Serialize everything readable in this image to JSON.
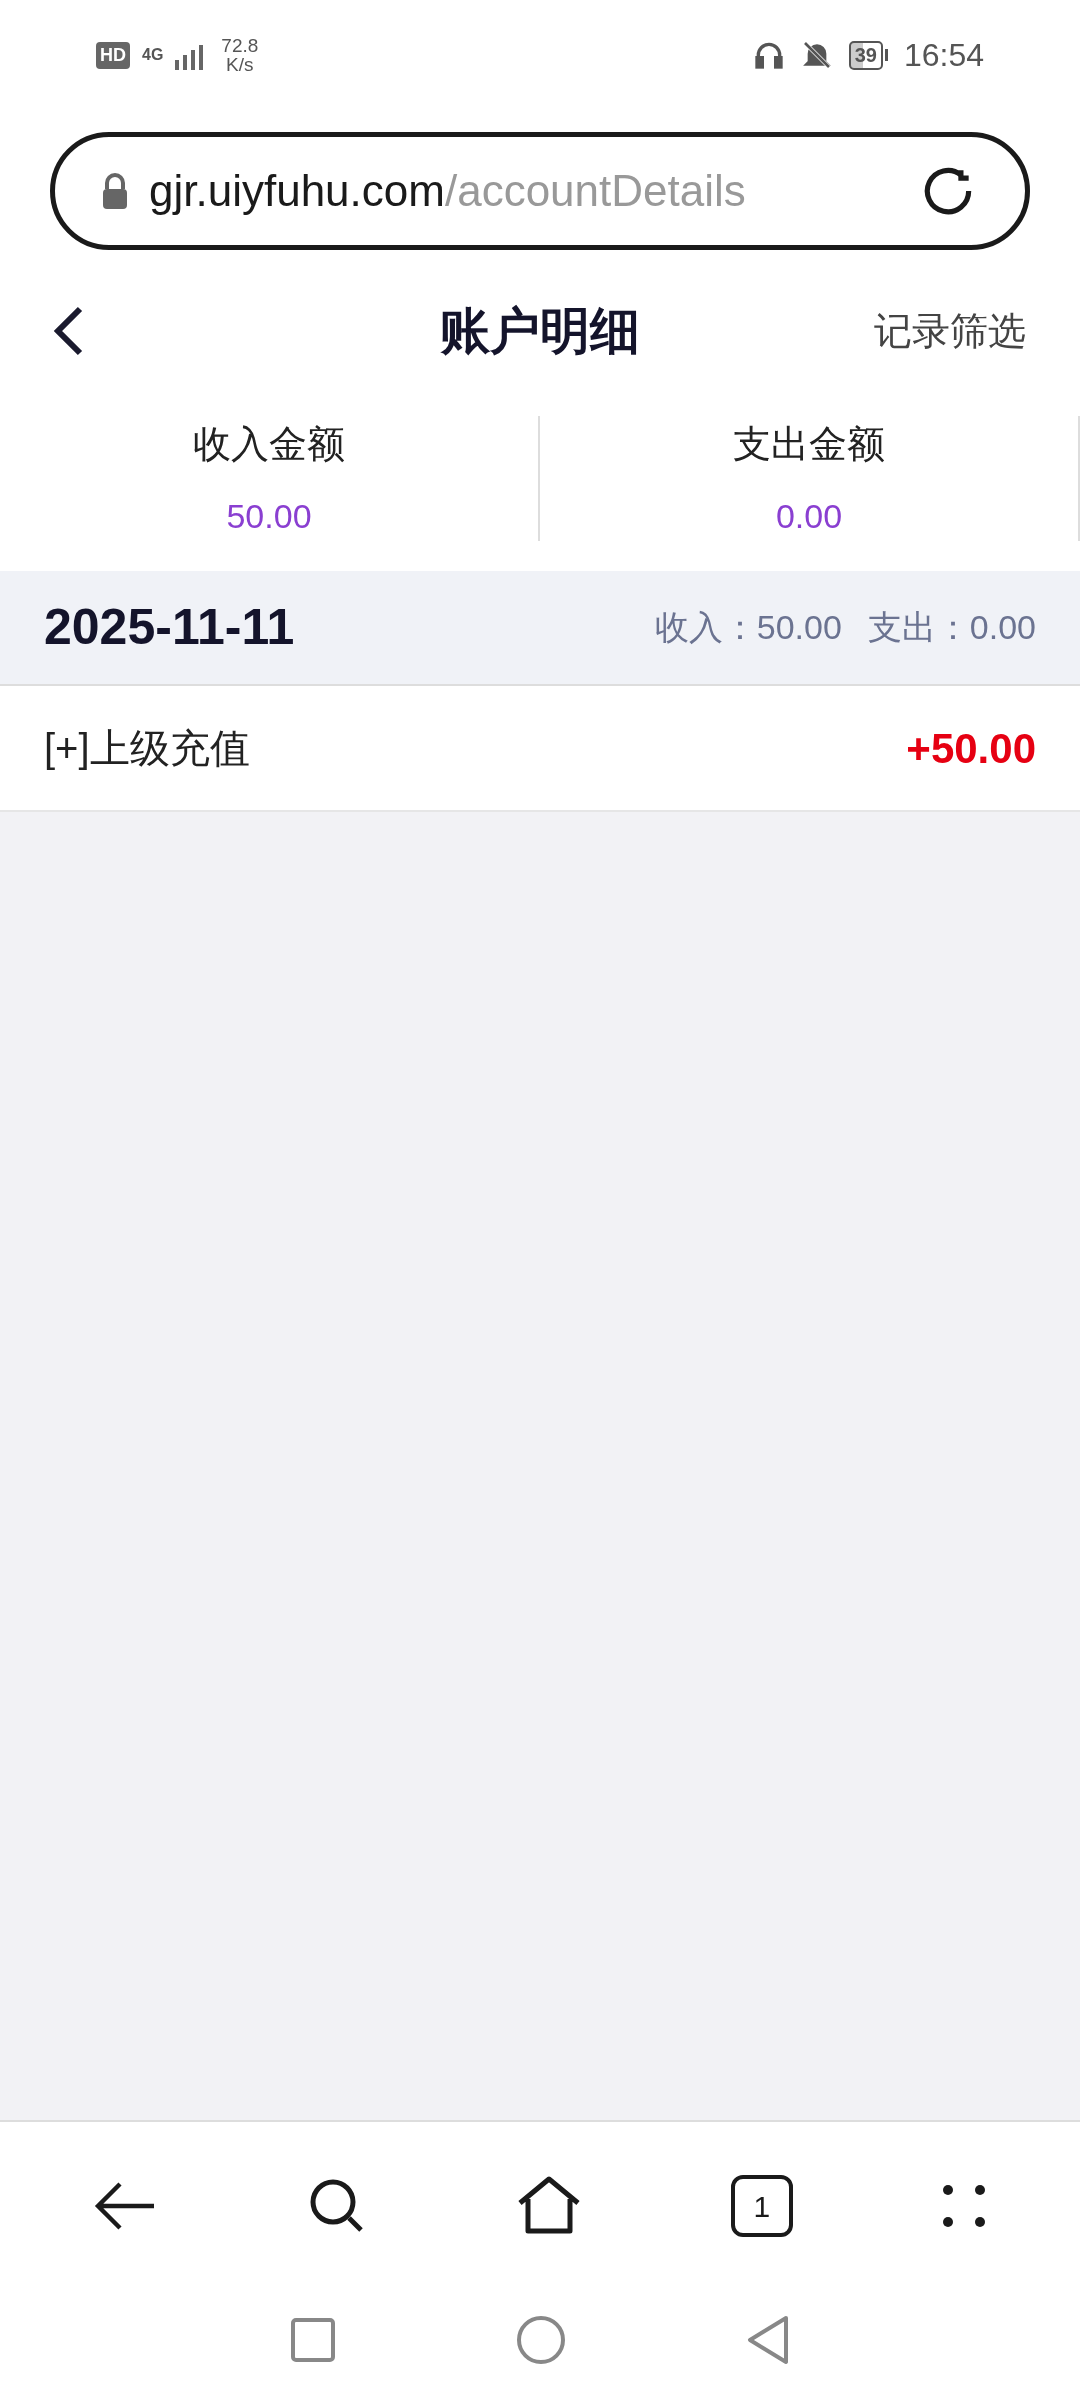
{
  "status_bar": {
    "hd": "HD",
    "network": "4G",
    "speed_value": "72.8",
    "speed_unit": "K/s",
    "battery": "39",
    "time": "16:54"
  },
  "address_bar": {
    "domain": "gjr.uiyfuhu.com",
    "path": "/accountDetails"
  },
  "header": {
    "title": "账户明细",
    "action": "记录筛选"
  },
  "summary": [
    {
      "label": "收入金额",
      "value": "50.00"
    },
    {
      "label": "支出金额",
      "value": "0.00"
    }
  ],
  "groups": [
    {
      "date": "2025-11-11",
      "income": "收入：50.00",
      "expense": "支出：0.00",
      "records": [
        {
          "title": "[+]上级充值",
          "amount": "+50.00",
          "kind": "income"
        }
      ]
    }
  ],
  "browser_toolbar": {
    "tab_count": "1"
  }
}
